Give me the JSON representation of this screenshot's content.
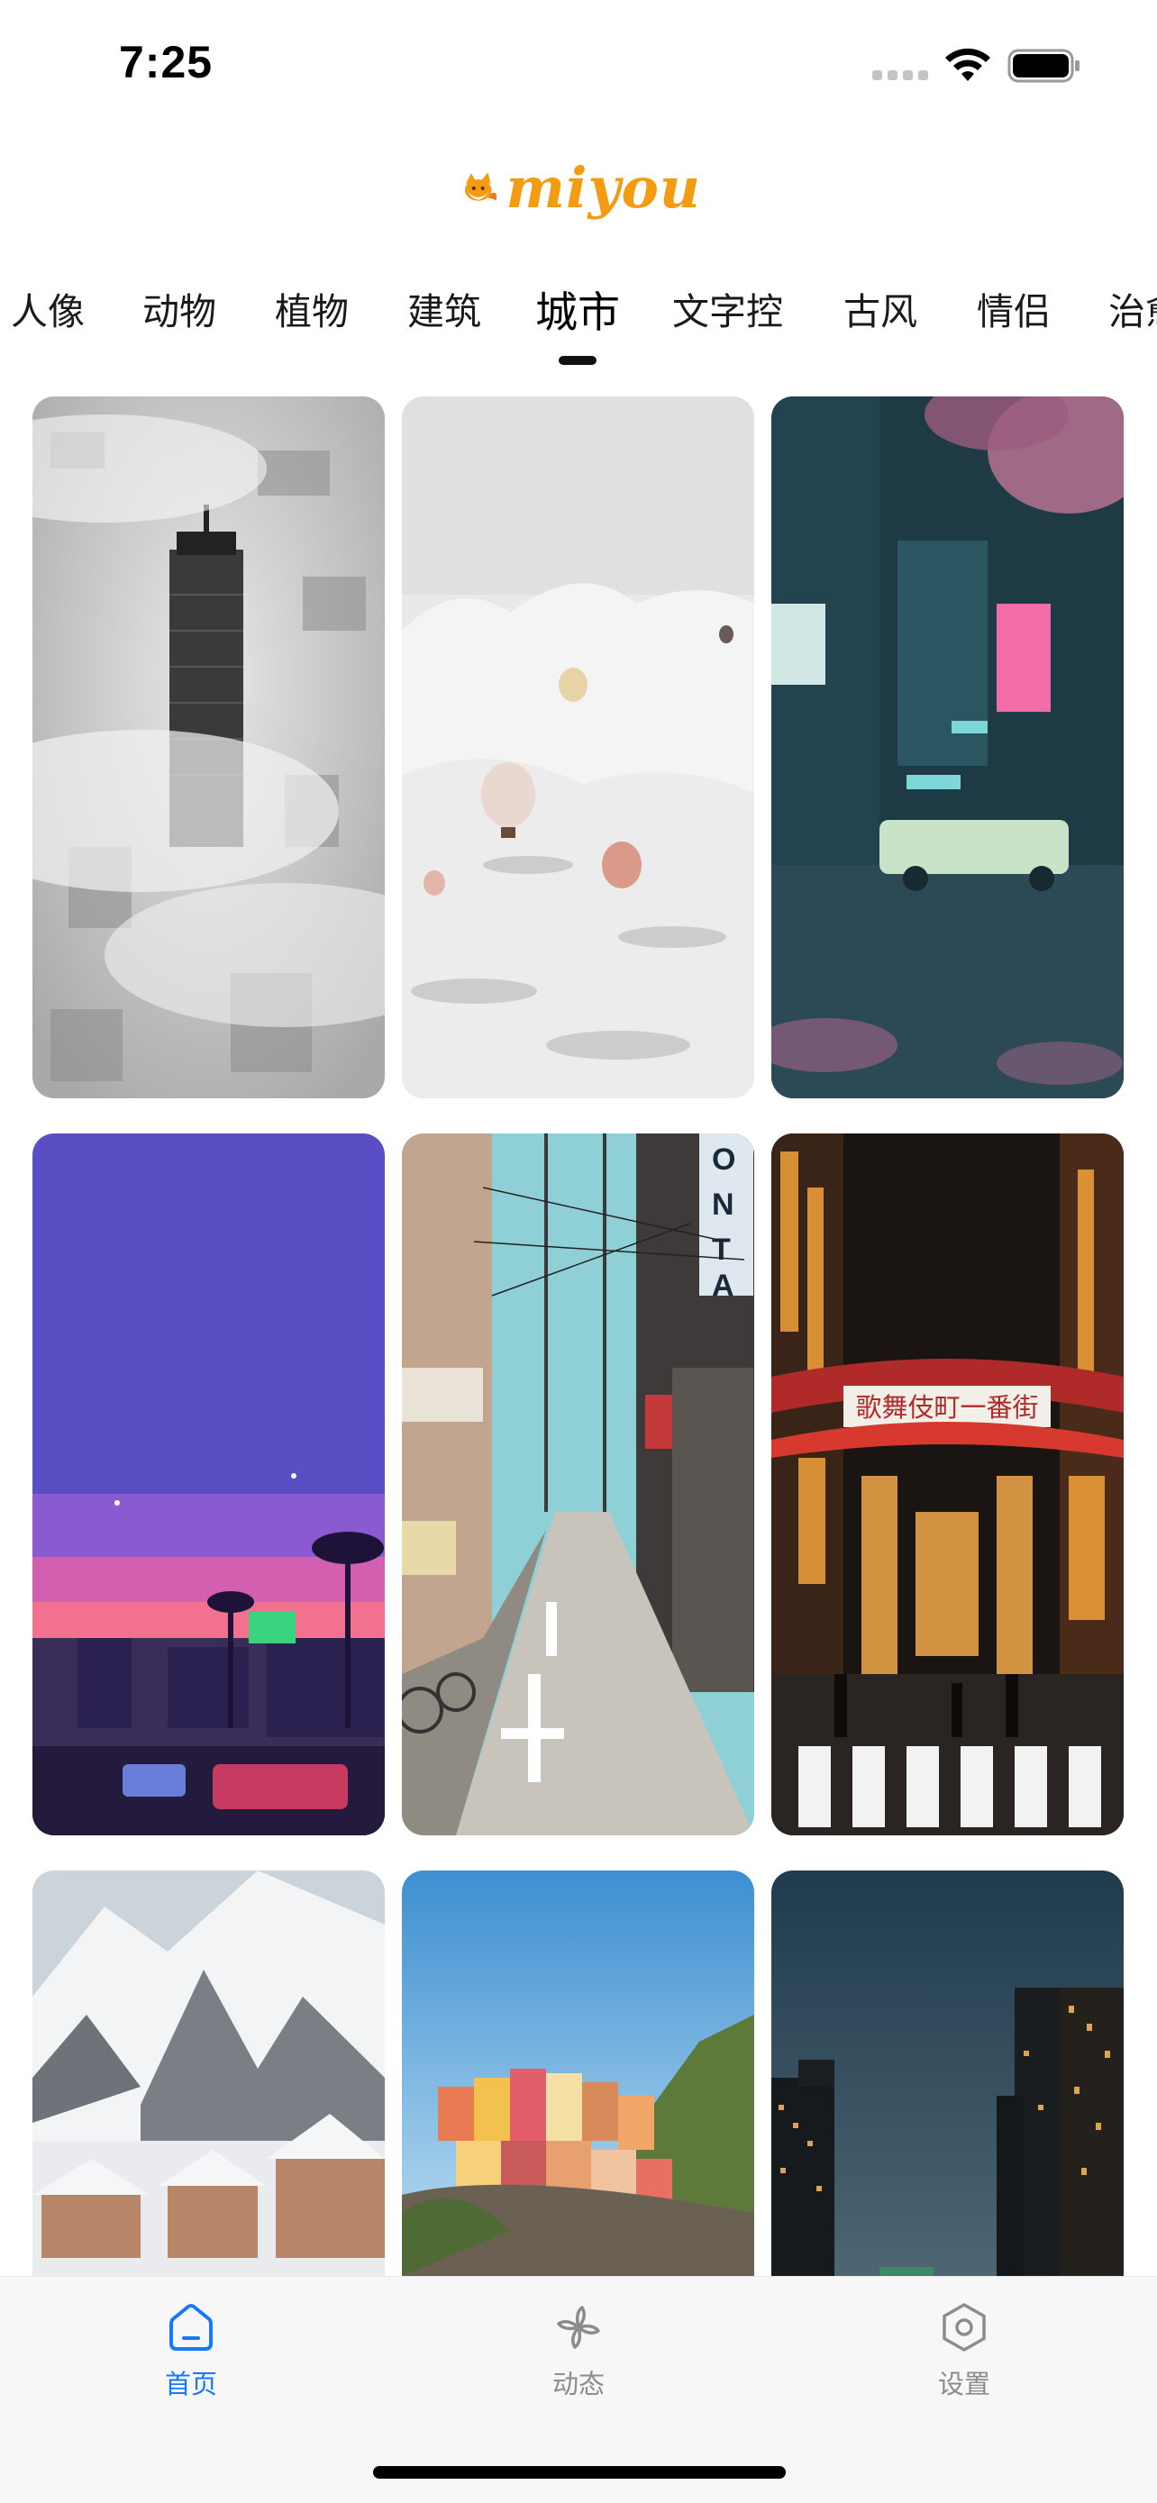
{
  "status_bar": {
    "time": "7:25"
  },
  "logo": {
    "text": "miyou"
  },
  "categories": {
    "items": [
      "人像",
      "动物",
      "植物",
      "建筑",
      "城市",
      "文字控",
      "古风",
      "情侣",
      "治愈"
    ],
    "active": "城市"
  },
  "wallpapers": [
    {
      "subject": "foggy city skyscraper"
    },
    {
      "subject": "hot air balloons over snowy hills"
    },
    {
      "subject": "pixel-art night street with cherry blossoms"
    },
    {
      "subject": "pixel-art purple sunset city street"
    },
    {
      "subject": "narrow Japanese street with utility poles",
      "sign_text": "ONTA"
    },
    {
      "subject": "Kabukicho night gate",
      "sign_text": "歌舞伎町一番街"
    },
    {
      "subject": "snowy mountain village"
    },
    {
      "subject": "colorful cliffside houses"
    },
    {
      "subject": "city skyline at dusk"
    }
  ],
  "bottom_nav": {
    "home": "首页",
    "feed": "动态",
    "settings": "设置"
  },
  "colors": {
    "accent": "#1677ff",
    "logo": "#f39c12"
  }
}
